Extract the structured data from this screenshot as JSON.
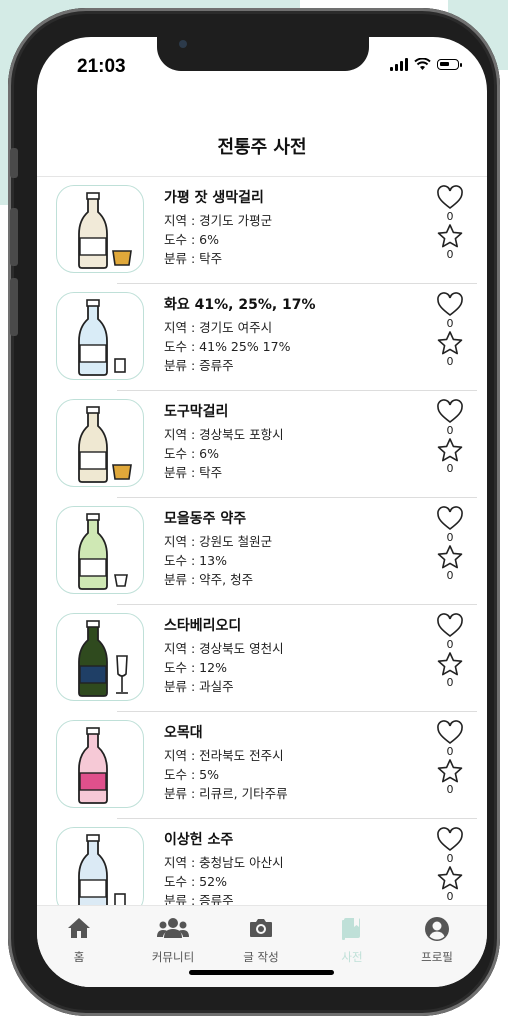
{
  "status": {
    "time": "21:03"
  },
  "header": {
    "title": "전통주 사전"
  },
  "items": [
    {
      "name": "가평 잣 생막걸리",
      "region": "지역 : 경기도 가평군",
      "abv": "도수 : 6%",
      "category": "분류 : 탁주",
      "likes": "0",
      "favorites": "0",
      "bottle_color": "#f1ead8",
      "label_color": "#ffffff",
      "glass": "cup"
    },
    {
      "name": "화요 41%, 25%, 17%",
      "region": "지역 : 경기도 여주시",
      "abv": "도수 : 41%  25%  17%",
      "category": "분류 : 증류주",
      "likes": "0",
      "favorites": "0",
      "bottle_color": "#d9ecf7",
      "label_color": "#ffffff",
      "glass": "shot"
    },
    {
      "name": "도구막걸리",
      "region": "지역 : 경상북도 포항시",
      "abv": "도수 : 6%",
      "category": "분류 : 탁주",
      "likes": "0",
      "favorites": "0",
      "bottle_color": "#efe8d2",
      "label_color": "#ffffff",
      "glass": "cup"
    },
    {
      "name": "모을동주 약주",
      "region": "지역 : 강원도 철원군",
      "abv": "도수 : 13%",
      "category": "분류 : 약주, 청주",
      "likes": "0",
      "favorites": "0",
      "bottle_color": "#cfe8b4",
      "label_color": "#ffffff",
      "glass": "small"
    },
    {
      "name": "스타베리오디",
      "region": "지역 : 경상북도 영천시",
      "abv": "도수 : 12%",
      "category": "분류 : 과실주",
      "likes": "0",
      "favorites": "0",
      "bottle_color": "#2f4a1e",
      "label_color": "#1f3f66",
      "glass": "wine"
    },
    {
      "name": "오목대",
      "region": "지역 : 전라북도 전주시",
      "abv": "도수 : 5%",
      "category": "분류 : 리큐르, 기타주류",
      "likes": "0",
      "favorites": "0",
      "bottle_color": "#f6c9d6",
      "label_color": "#e0508c",
      "glass": "none"
    },
    {
      "name": "이상헌 소주",
      "region": "지역 : 충청남도 아산시",
      "abv": "도수 : 52%",
      "category": "분류 : 증류주",
      "likes": "0",
      "favorites": "0",
      "bottle_color": "#dbeaf5",
      "label_color": "#ffffff",
      "glass": "shot"
    }
  ],
  "tabs": [
    {
      "label": "홈",
      "icon": "home-icon"
    },
    {
      "label": "커뮤니티",
      "icon": "community-icon"
    },
    {
      "label": "글 작성",
      "icon": "camera-icon"
    },
    {
      "label": "사전",
      "icon": "book-icon",
      "active": true
    },
    {
      "label": "프로필",
      "icon": "profile-icon"
    }
  ],
  "colors": {
    "accent": "#bfe0d8",
    "tab_icon": "#555555",
    "background_block": "#d4ebe6"
  }
}
